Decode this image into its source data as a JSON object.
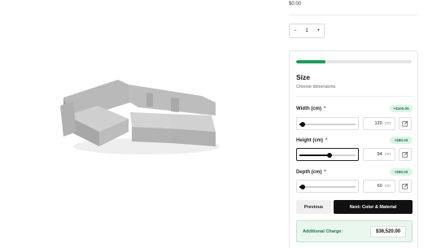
{
  "product": {
    "price": "$0.00"
  },
  "quantity": {
    "decrement": "−",
    "value": "1",
    "increment": "+"
  },
  "step": {
    "progress_fraction": 0.25,
    "title": "Size",
    "subtitle": "Choose dimensions"
  },
  "dimensions": [
    {
      "label": "Width (cm)",
      "required": "*",
      "badge": "+$100.00",
      "value": "120",
      "unit": "cm",
      "slider_fraction": 0.06,
      "active": false
    },
    {
      "label": "Height (cm)",
      "required": "*",
      "badge": "+$80.00",
      "value": "94",
      "unit": "cm",
      "slider_fraction": 0.53,
      "active": true
    },
    {
      "label": "Depth (cm)",
      "required": "*",
      "badge": "+$90.00",
      "value": "60",
      "unit": "cm",
      "slider_fraction": 0.06,
      "active": false
    }
  ],
  "actions": {
    "previous_label": "Previous",
    "next_label": "Next: Color & Material"
  },
  "charge": {
    "label": "Additional Charge:",
    "value": "$36,520.00"
  },
  "colors": {
    "accent_green": "#16a05a",
    "badge_bg": "#dcf3e6",
    "primary_button": "#111111",
    "required": "#d62828"
  },
  "icons": {
    "edit": "pencil-square-icon"
  }
}
